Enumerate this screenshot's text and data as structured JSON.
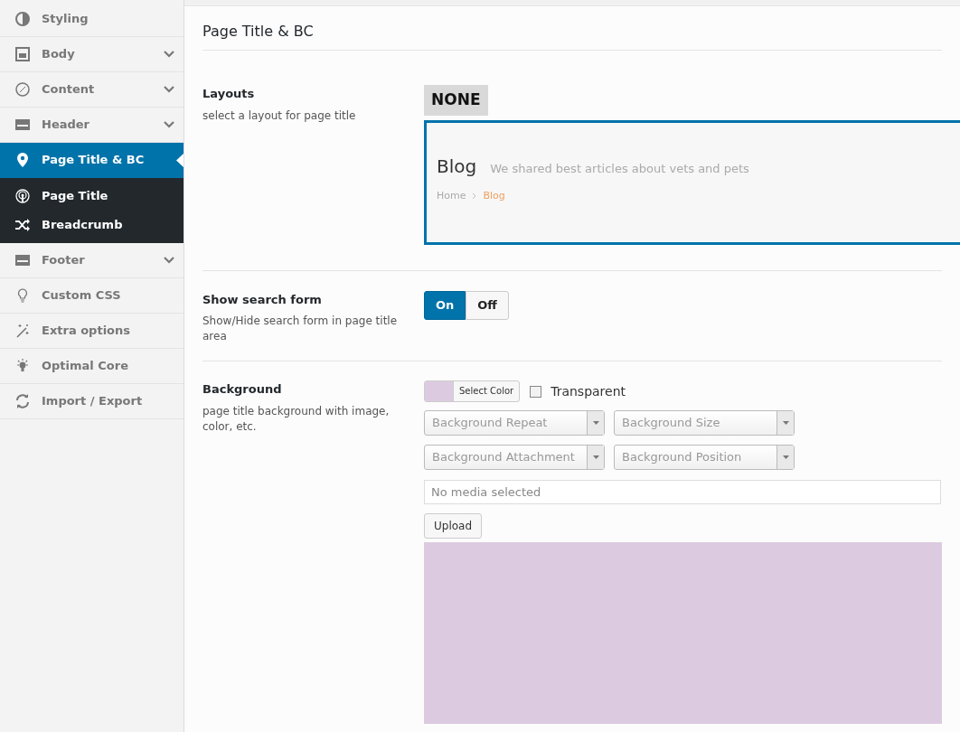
{
  "sidebar": {
    "items": [
      {
        "label": "Styling",
        "has_chevron": false,
        "selected": false
      },
      {
        "label": "Body",
        "has_chevron": true,
        "selected": false
      },
      {
        "label": "Content",
        "has_chevron": true,
        "selected": false
      },
      {
        "label": "Header",
        "has_chevron": true,
        "selected": false
      },
      {
        "label": "Page Title & BC",
        "has_chevron": false,
        "selected": true,
        "children": [
          {
            "label": "Page Title"
          },
          {
            "label": "Breadcrumb"
          }
        ]
      },
      {
        "label": "Footer",
        "has_chevron": true,
        "selected": false
      },
      {
        "label": "Custom CSS",
        "has_chevron": false,
        "selected": false
      },
      {
        "label": "Extra options",
        "has_chevron": false,
        "selected": false
      },
      {
        "label": "Optimal Core",
        "has_chevron": false,
        "selected": false
      },
      {
        "label": "Import / Export",
        "has_chevron": false,
        "selected": false
      }
    ]
  },
  "section_title": "Page Title & BC",
  "layouts": {
    "label": "Layouts",
    "description": "select a layout for page title",
    "options": [
      {
        "label": "NONE",
        "selected": false
      },
      {
        "kind": "preview",
        "title": "Blog",
        "subtitle": "We shared best articles about vets and pets",
        "breadcrumb": [
          "Home",
          "Blog"
        ],
        "selected": true
      }
    ]
  },
  "search_form": {
    "label": "Show search form",
    "description": "Show/Hide search form in page title area",
    "options": [
      {
        "label": "On",
        "selected": true
      },
      {
        "label": "Off",
        "selected": false
      }
    ]
  },
  "background": {
    "label": "Background",
    "description": "page title background with image, color, etc.",
    "color": "#dccbe0",
    "color_button": "Select Color",
    "transparent": {
      "label": "Transparent",
      "checked": false
    },
    "selects": [
      "Background Repeat",
      "Background Size",
      "Background Attachment",
      "Background Position"
    ],
    "media_placeholder": "No media selected",
    "upload_button": "Upload"
  }
}
